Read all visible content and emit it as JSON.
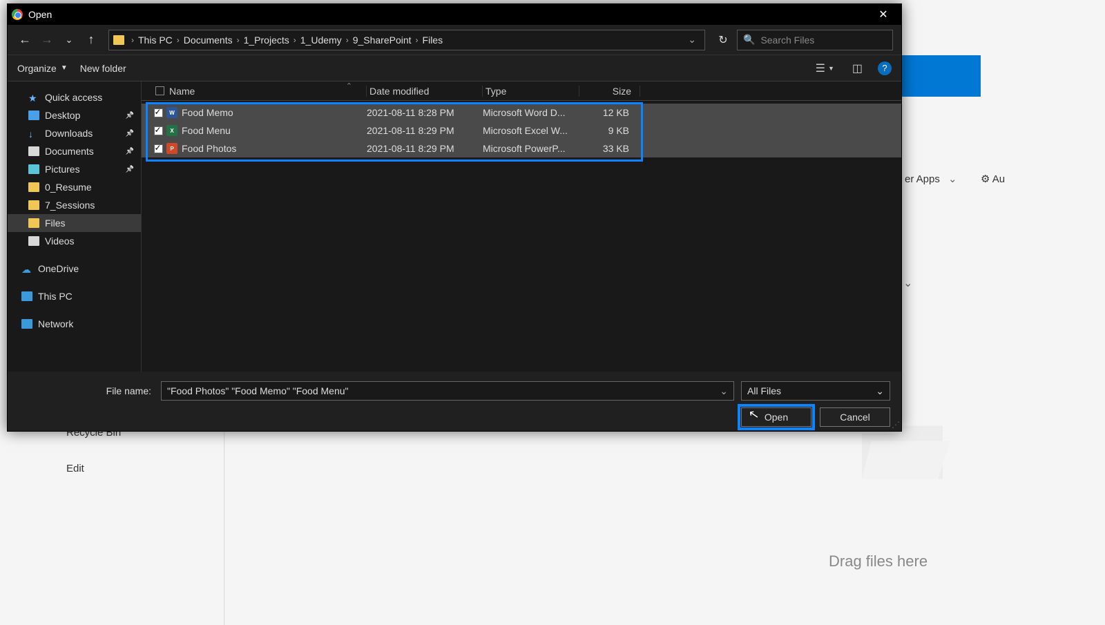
{
  "window": {
    "title": "Open"
  },
  "breadcrumb": {
    "root": "This PC",
    "items": [
      "Documents",
      "1_Projects",
      "1_Udemy",
      "9_SharePoint",
      "Files"
    ]
  },
  "search": {
    "placeholder": "Search Files"
  },
  "toolbar": {
    "organize": "Organize",
    "newfolder": "New folder"
  },
  "sidebar": {
    "quick": "Quick access",
    "desktop": "Desktop",
    "downloads": "Downloads",
    "documents": "Documents",
    "pictures": "Pictures",
    "resume": "0_Resume",
    "sessions": "7_Sessions",
    "files": "Files",
    "videos": "Videos",
    "onedrive": "OneDrive",
    "thispc": "This PC",
    "network": "Network"
  },
  "columns": {
    "name": "Name",
    "date": "Date modified",
    "type": "Type",
    "size": "Size"
  },
  "files": [
    {
      "name": "Food Memo",
      "date": "2021-08-11 8:28 PM",
      "type": "Microsoft Word D...",
      "size": "12 KB",
      "icon": "word",
      "letter": "W"
    },
    {
      "name": "Food Menu",
      "date": "2021-08-11 8:29 PM",
      "type": "Microsoft Excel W...",
      "size": "9 KB",
      "icon": "excel",
      "letter": "X"
    },
    {
      "name": "Food Photos",
      "date": "2021-08-11 8:29 PM",
      "type": "Microsoft PowerP...",
      "size": "33 KB",
      "icon": "ppt",
      "letter": "P"
    }
  ],
  "footer": {
    "label": "File name:",
    "filename": "\"Food Photos\" \"Food Memo\" \"Food Menu\"",
    "filter": "All Files",
    "open": "Open",
    "cancel": "Cancel"
  },
  "background": {
    "apps": "er Apps",
    "au": "Au",
    "recycle": "Recycle Bin",
    "edit": "Edit",
    "drag": "Drag files here"
  }
}
